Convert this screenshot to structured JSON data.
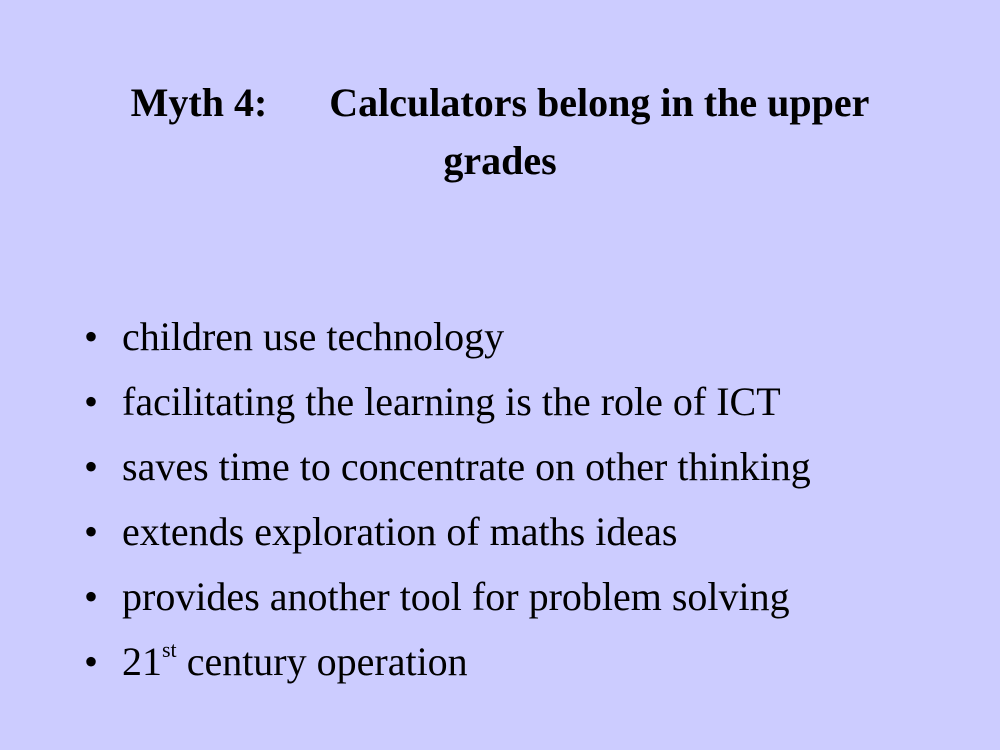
{
  "slide": {
    "title_prefix": "Myth 4:",
    "title_line1": "Calculators belong in the upper",
    "title_line2": "grades"
  },
  "bullet_char": "•",
  "bullets": [
    {
      "text": "children use technology"
    },
    {
      "text": "facilitating the learning is the role of ICT"
    },
    {
      "text": "saves time to concentrate on other thinking"
    },
    {
      "text": "extends exploration of maths ideas"
    },
    {
      "text": "provides another tool for problem solving"
    },
    {
      "number": "21",
      "suffix": "st",
      "text": " century operation"
    }
  ]
}
